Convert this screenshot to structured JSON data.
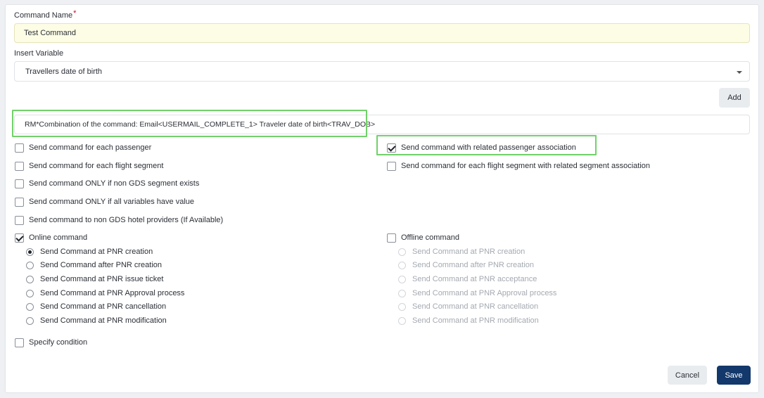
{
  "form": {
    "command_name_label": "Command Name",
    "required_mark": "*",
    "command_name_value": "Test Command",
    "insert_variable_label": "Insert Variable",
    "insert_variable_value": "Travellers date of birth",
    "add_button": "Add",
    "command_text": "RM*Combination of the command: Email<USERMAIL_COMPLETE_1> Traveler date of birth<TRAV_DOB>"
  },
  "options_left": [
    {
      "label": "Send command for each passenger",
      "checked": false
    },
    {
      "label": "Send command for each flight segment",
      "checked": false
    },
    {
      "label": "Send command ONLY if non GDS segment exists",
      "checked": false
    },
    {
      "label": "Send command ONLY if all variables have value",
      "checked": false
    },
    {
      "label": "Send command to non GDS hotel providers (If Available)",
      "checked": false
    }
  ],
  "options_right": [
    {
      "label": "Send command with related passenger association",
      "checked": true
    },
    {
      "label": "Send command for each flight segment with related segment association",
      "checked": false
    }
  ],
  "online": {
    "label": "Online command",
    "checked": true,
    "options": [
      {
        "label": "Send Command at PNR creation",
        "selected": true
      },
      {
        "label": "Send Command after PNR creation",
        "selected": false
      },
      {
        "label": "Send Command at PNR issue ticket",
        "selected": false
      },
      {
        "label": "Send Command at PNR Approval process",
        "selected": false
      },
      {
        "label": "Send Command at PNR cancellation",
        "selected": false
      },
      {
        "label": "Send Command at PNR modification",
        "selected": false
      }
    ]
  },
  "offline": {
    "label": "Offline command",
    "checked": false,
    "options": [
      {
        "label": "Send Command at PNR creation",
        "selected": false
      },
      {
        "label": "Send Command after PNR creation",
        "selected": false
      },
      {
        "label": "Send Command at PNR acceptance",
        "selected": false
      },
      {
        "label": "Send Command at PNR Approval process",
        "selected": false
      },
      {
        "label": "Send Command at PNR cancellation",
        "selected": false
      },
      {
        "label": "Send Command at PNR modification",
        "selected": false
      }
    ]
  },
  "specify_condition": {
    "label": "Specify condition",
    "checked": false
  },
  "footer": {
    "cancel": "Cancel",
    "save": "Save"
  },
  "colors": {
    "primary": "#13386b",
    "highlight": "#71d16a",
    "filled_field": "#fdfde6"
  }
}
